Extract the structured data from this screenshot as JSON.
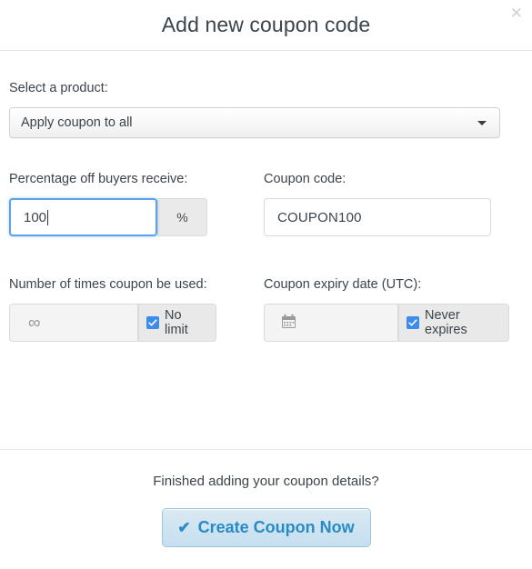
{
  "modal": {
    "title": "Add new coupon code",
    "close_label": "✕"
  },
  "form": {
    "product": {
      "label": "Select a product:",
      "selected": "Apply coupon to all",
      "caret_icon": "chevron-down-icon"
    },
    "percentage": {
      "label": "Percentage off buyers receive:",
      "value": "100",
      "placeholder": "",
      "addon": "%",
      "focused": true
    },
    "coupon_code": {
      "label": "Coupon code:",
      "value": "COUPON100",
      "placeholder": "Coupon code"
    },
    "usage_limit": {
      "label": "Number of times coupon be used:",
      "value": "",
      "placeholder": "",
      "icon": "infinity-icon",
      "icon_glyph": "∞",
      "checkbox_label": "No limit",
      "checked": true
    },
    "expiry": {
      "label": "Coupon expiry date (UTC):",
      "value": "",
      "placeholder": "",
      "icon": "calendar-icon",
      "checkbox_label": "Never expires",
      "checked": true
    }
  },
  "footer": {
    "question": "Finished adding your coupon details?",
    "submit_label": "Create Coupon Now",
    "submit_icon": "check-icon",
    "submit_icon_glyph": "✔"
  },
  "colors": {
    "accent_blue": "#3b8ced",
    "button_text": "#2a8bc4",
    "button_bg": "#cfe4f1",
    "button_border": "#9cc6de",
    "focus_border": "#5ba3e8",
    "text": "#3b434b",
    "border": "#d8dbdd",
    "addon_bg": "#e9e9e9"
  }
}
